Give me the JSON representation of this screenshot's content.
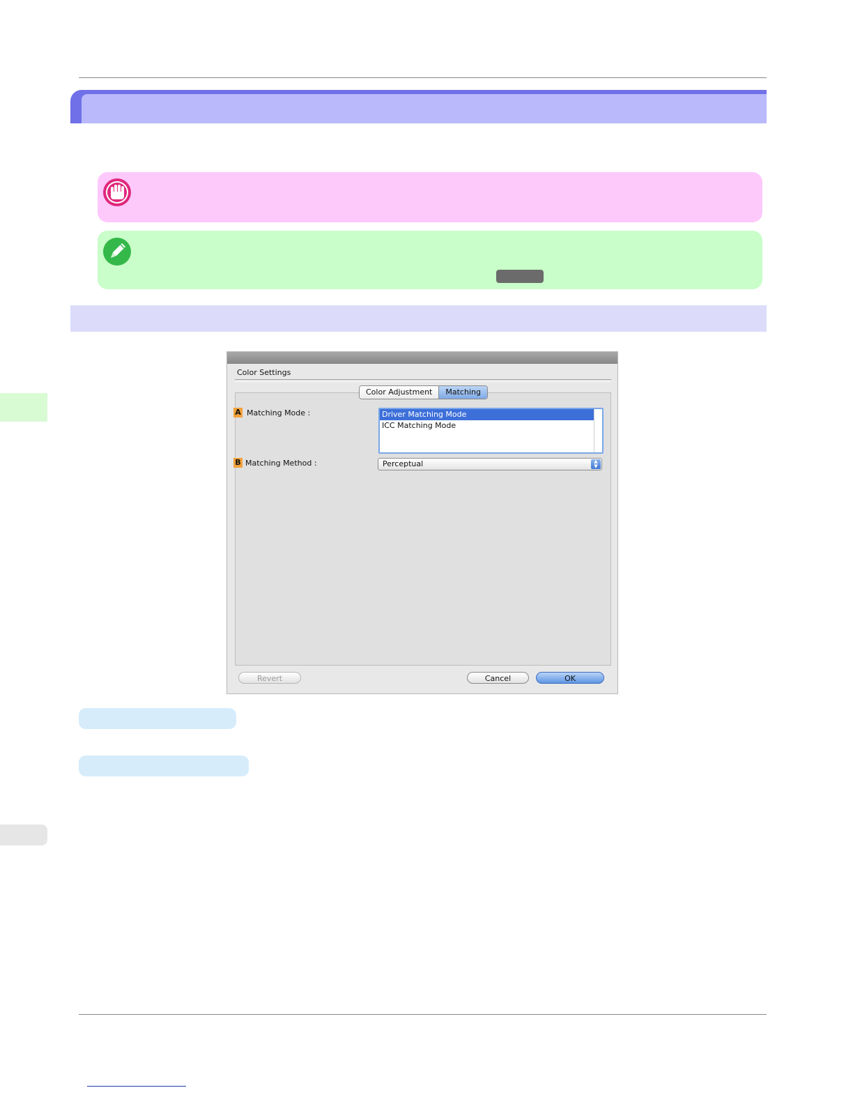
{
  "dialog": {
    "title": "Color Settings",
    "tabs": [
      {
        "label": "Color Adjustment",
        "active": false
      },
      {
        "label": "Matching",
        "active": true
      }
    ],
    "matching_mode": {
      "badge": "A",
      "label": "Matching Mode :",
      "options": [
        "Driver Matching Mode",
        "ICC Matching Mode"
      ],
      "selected": "Driver Matching Mode"
    },
    "matching_method": {
      "badge": "B",
      "label": "Matching Method :",
      "value": "Perceptual"
    },
    "buttons": {
      "revert": "Revert",
      "cancel": "Cancel",
      "ok": "OK"
    }
  },
  "colors": {
    "title_bar": "#7070e8",
    "important_box": "#fdc9fb",
    "note_box": "#c9fdc9",
    "section_bar": "#dcdcfa",
    "option_pill": "#d6ecfb"
  },
  "icons": [
    "important-hand-icon",
    "note-pencil-icon"
  ]
}
